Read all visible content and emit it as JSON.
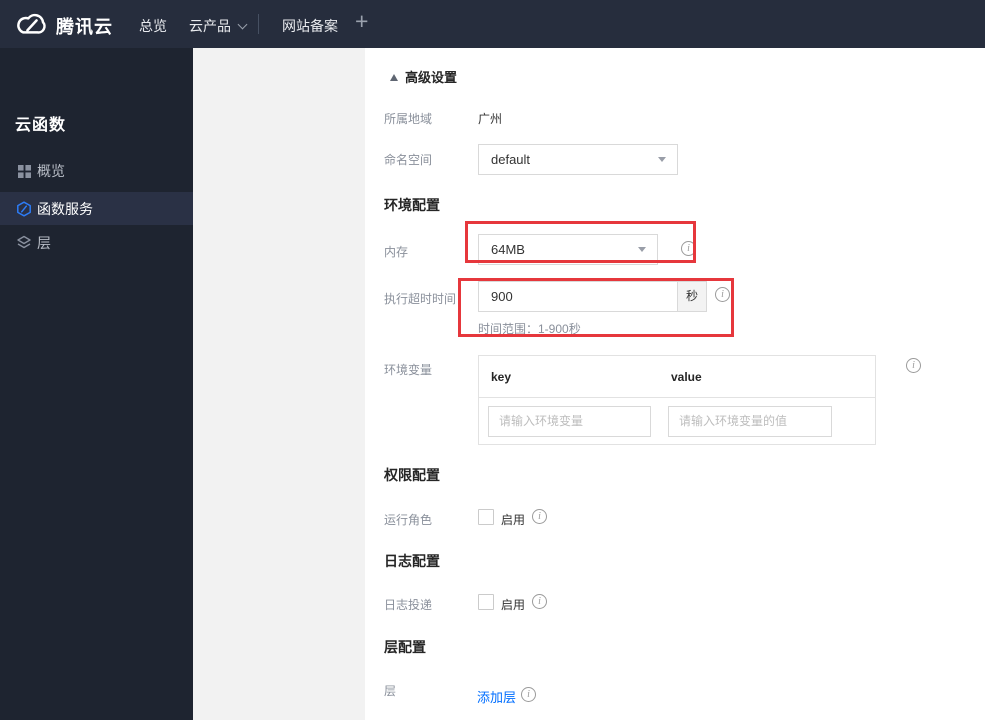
{
  "topnav": {
    "brand": "腾讯云",
    "items": [
      {
        "label": "总览"
      },
      {
        "label": "云产品"
      },
      {
        "label": "网站备案"
      }
    ],
    "add_label": "+"
  },
  "sidebar": {
    "title": "云函数",
    "items": [
      {
        "label": "概览",
        "icon": "grid-icon",
        "active": false
      },
      {
        "label": "函数服务",
        "icon": "scf-hexagon-icon",
        "active": true
      },
      {
        "label": "层",
        "icon": "layers-icon",
        "active": false
      }
    ]
  },
  "content": {
    "advanced_toggle": "高级设置",
    "region": {
      "label": "所属地域",
      "value": "广州"
    },
    "namespace": {
      "label": "命名空间",
      "value": "default"
    },
    "sections": {
      "env": "环境配置",
      "permission": "权限配置",
      "log": "日志配置",
      "layer": "层配置"
    },
    "memory": {
      "label": "内存",
      "value": "64MB"
    },
    "timeout": {
      "label": "执行超时时间",
      "value": "900",
      "unit": "秒",
      "hint": "时间范围：1-900秒"
    },
    "env_vars": {
      "label": "环境变量",
      "columns": [
        "key",
        "value"
      ],
      "key_placeholder": "请输入环境变量",
      "value_placeholder": "请输入环境变量的值"
    },
    "role": {
      "label": "运行角色",
      "enable_label": "启用"
    },
    "log_delivery": {
      "label": "日志投递",
      "enable_label": "启用"
    },
    "layer": {
      "label": "层",
      "add_link": "添加层"
    }
  },
  "icons": {
    "info_glyph": "i"
  },
  "colors": {
    "topnav_bg": "#262d3d",
    "sidebar_bg": "#1e2430",
    "active_item_bg": "#2a3145",
    "accent_blue": "#006eff",
    "annotation_red": "#e6373c"
  }
}
